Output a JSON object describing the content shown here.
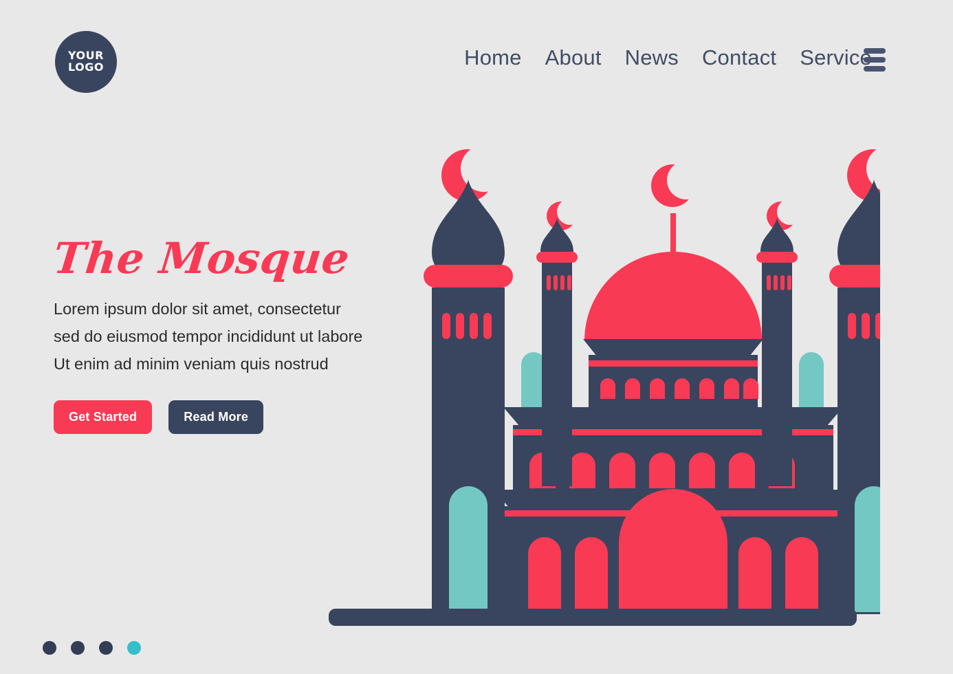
{
  "theme": {
    "background": "#e8e8e8",
    "navy": "#39455E",
    "red": "#F93A55",
    "teal": "#74C8C3",
    "teal_active_dot": "#35BECB",
    "white": "#FFFFFF"
  },
  "header": {
    "logo": {
      "line1": "YOUR",
      "line2": "LOGO"
    },
    "nav": [
      {
        "label": "Home"
      },
      {
        "label": "About"
      },
      {
        "label": "News"
      },
      {
        "label": "Contact"
      },
      {
        "label": "Service"
      }
    ],
    "menu_icon": "hamburger-icon"
  },
  "hero": {
    "title": "The Mosque",
    "description_lines": [
      "Lorem ipsum dolor sit amet, consectetur",
      "sed do eiusmod tempor incididunt ut labore",
      "Ut enim ad minim veniam quis nostrud"
    ],
    "primary_button": "Get Started",
    "secondary_button": "Read More"
  },
  "carousel": {
    "dots": [
      {
        "active": false
      },
      {
        "active": false
      },
      {
        "active": false
      },
      {
        "active": true
      }
    ],
    "active_index": 3,
    "total": 4
  },
  "illustration": {
    "name": "mosque-illustration",
    "elements": [
      "crescent-moon-finial",
      "onion-dome-minaret",
      "central-dome",
      "arched-windows",
      "teal-pillars",
      "ground-bar"
    ]
  }
}
